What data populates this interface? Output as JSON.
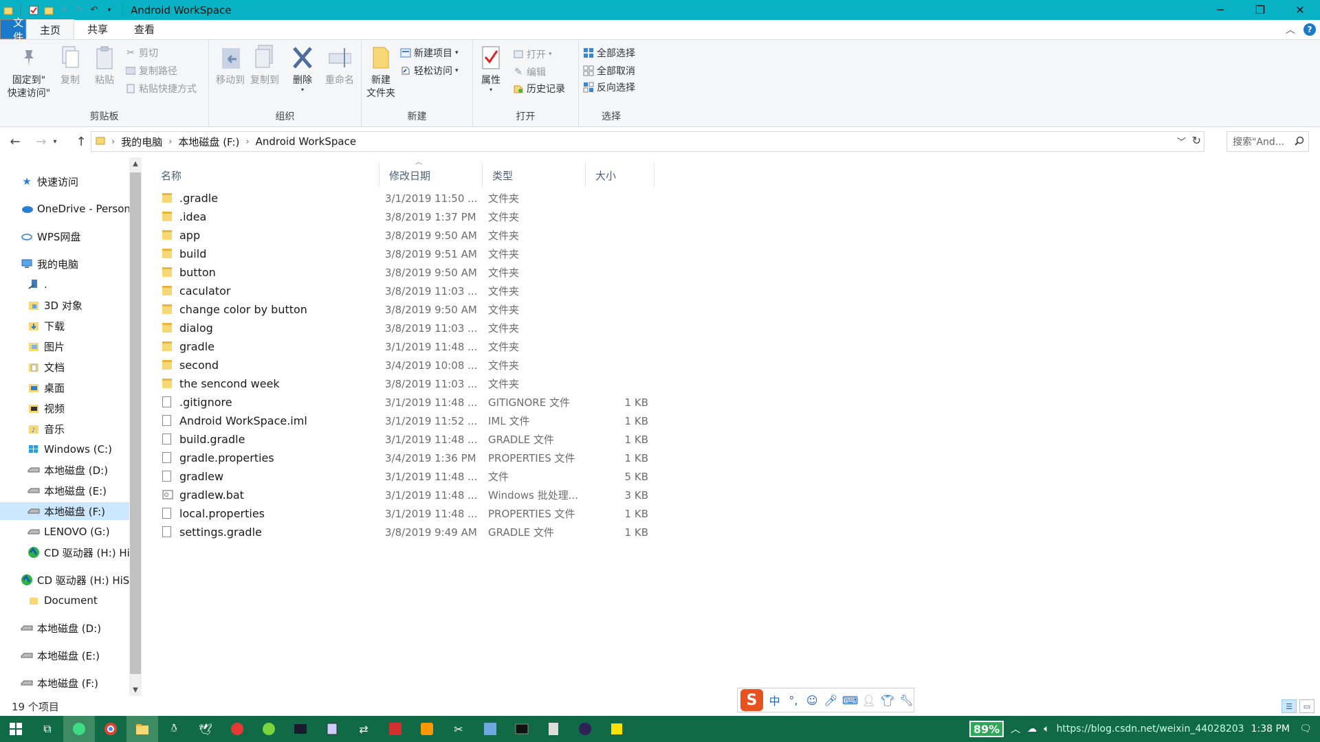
{
  "window": {
    "title": "Android WorkSpace"
  },
  "menu": {
    "file": "文件",
    "home": "主页",
    "share": "共享",
    "view": "查看"
  },
  "ribbon": {
    "clipboard": {
      "label": "剪贴板",
      "pin_line1": "固定到\"",
      "pin_line2": "快速访问\"",
      "copy": "复制",
      "paste": "粘贴",
      "cut": "剪切",
      "copy_path": "复制路径",
      "paste_shortcut": "粘贴快捷方式"
    },
    "organize": {
      "label": "组织",
      "move_to": "移动到",
      "copy_to": "复制到",
      "delete": "删除",
      "rename": "重命名"
    },
    "new": {
      "label": "新建",
      "new_folder_line1": "新建",
      "new_folder_line2": "文件夹",
      "new_item": "新建项目",
      "easy_access": "轻松访问"
    },
    "open": {
      "label": "打开",
      "properties": "属性",
      "open": "打开",
      "edit": "编辑",
      "history": "历史记录"
    },
    "select": {
      "label": "选择",
      "select_all": "全部选择",
      "select_none": "全部取消",
      "invert": "反向选择"
    }
  },
  "address": {
    "crumbs": [
      "我的电脑",
      "本地磁盘 (F:)",
      "Android WorkSpace"
    ],
    "search_placeholder": "搜索\"And..."
  },
  "nav": {
    "quick_access": "快速访问",
    "onedrive": "OneDrive - Person",
    "wps": "WPS网盘",
    "this_pc": "我的电脑",
    "dot": ".",
    "objects3d": "3D 对象",
    "downloads": "下载",
    "pictures": "图片",
    "documents": "文档",
    "desktop": "桌面",
    "videos": "视频",
    "music": "音乐",
    "drive_c": "Windows (C:)",
    "drive_d": "本地磁盘 (D:)",
    "drive_e": "本地磁盘 (E:)",
    "drive_f": "本地磁盘 (F:)",
    "drive_g": "LENOVO (G:)",
    "drive_h": "CD 驱动器 (H:) Hi",
    "cd_root": "CD 驱动器 (H:) HiSu",
    "document": "Document",
    "root_d": "本地磁盘 (D:)",
    "root_e": "本地磁盘 (E:)",
    "root_f": "本地磁盘 (F:)"
  },
  "columns": {
    "name": "名称",
    "date": "修改日期",
    "type": "类型",
    "size": "大小"
  },
  "files": [
    {
      "name": ".gradle",
      "date": "3/1/2019 11:50 ...",
      "type": "文件夹",
      "size": "",
      "kind": "folder"
    },
    {
      "name": ".idea",
      "date": "3/8/2019 1:37 PM",
      "type": "文件夹",
      "size": "",
      "kind": "folder"
    },
    {
      "name": "app",
      "date": "3/8/2019 9:50 AM",
      "type": "文件夹",
      "size": "",
      "kind": "folder"
    },
    {
      "name": "build",
      "date": "3/8/2019 9:51 AM",
      "type": "文件夹",
      "size": "",
      "kind": "folder"
    },
    {
      "name": "button",
      "date": "3/8/2019 9:50 AM",
      "type": "文件夹",
      "size": "",
      "kind": "folder"
    },
    {
      "name": "caculator",
      "date": "3/8/2019 11:03 ...",
      "type": "文件夹",
      "size": "",
      "kind": "folder"
    },
    {
      "name": "change color by button",
      "date": "3/8/2019 9:50 AM",
      "type": "文件夹",
      "size": "",
      "kind": "folder"
    },
    {
      "name": "dialog",
      "date": "3/8/2019 11:03 ...",
      "type": "文件夹",
      "size": "",
      "kind": "folder"
    },
    {
      "name": "gradle",
      "date": "3/1/2019 11:48 ...",
      "type": "文件夹",
      "size": "",
      "kind": "folder"
    },
    {
      "name": "second",
      "date": "3/4/2019 10:08 ...",
      "type": "文件夹",
      "size": "",
      "kind": "folder"
    },
    {
      "name": "the sencond week",
      "date": "3/8/2019 11:03 ...",
      "type": "文件夹",
      "size": "",
      "kind": "folder"
    },
    {
      "name": ".gitignore",
      "date": "3/1/2019 11:48 ...",
      "type": "GITIGNORE 文件",
      "size": "1 KB",
      "kind": "file"
    },
    {
      "name": "Android WorkSpace.iml",
      "date": "3/1/2019 11:52 ...",
      "type": "IML 文件",
      "size": "1 KB",
      "kind": "file"
    },
    {
      "name": "build.gradle",
      "date": "3/1/2019 11:48 ...",
      "type": "GRADLE 文件",
      "size": "1 KB",
      "kind": "file"
    },
    {
      "name": "gradle.properties",
      "date": "3/4/2019 1:36 PM",
      "type": "PROPERTIES 文件",
      "size": "1 KB",
      "kind": "file"
    },
    {
      "name": "gradlew",
      "date": "3/1/2019 11:48 ...",
      "type": "文件",
      "size": "5 KB",
      "kind": "file"
    },
    {
      "name": "gradlew.bat",
      "date": "3/1/2019 11:48 ...",
      "type": "Windows 批处理...",
      "size": "3 KB",
      "kind": "bat"
    },
    {
      "name": "local.properties",
      "date": "3/1/2019 11:48 ...",
      "type": "PROPERTIES 文件",
      "size": "1 KB",
      "kind": "file"
    },
    {
      "name": "settings.gradle",
      "date": "3/8/2019 9:49 AM",
      "type": "GRADLE 文件",
      "size": "1 KB",
      "kind": "file"
    }
  ],
  "status": {
    "count": "19 个项目"
  },
  "ime": {
    "logo": "S",
    "lang": "中",
    "punct": "°,"
  },
  "tray": {
    "battery": "89%",
    "overlay": "https://blog.csdn.net/weixin_44028203",
    "time": "1:38 PM",
    "ime_lang": "中"
  },
  "colors": {
    "titlebar": "#06b2c3",
    "file_tab": "#1979ca",
    "taskbar": "#0f6a45"
  }
}
